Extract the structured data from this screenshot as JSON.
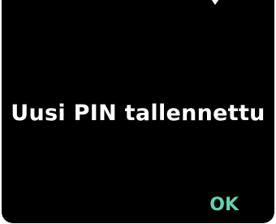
{
  "screen": {
    "message": "Uusi PIN tallennettu",
    "ok_label": "OK",
    "accent_color": "#5fd3b3",
    "background_color": "#000000"
  },
  "icons": {
    "top_indicator": "down-arrow-icon"
  }
}
